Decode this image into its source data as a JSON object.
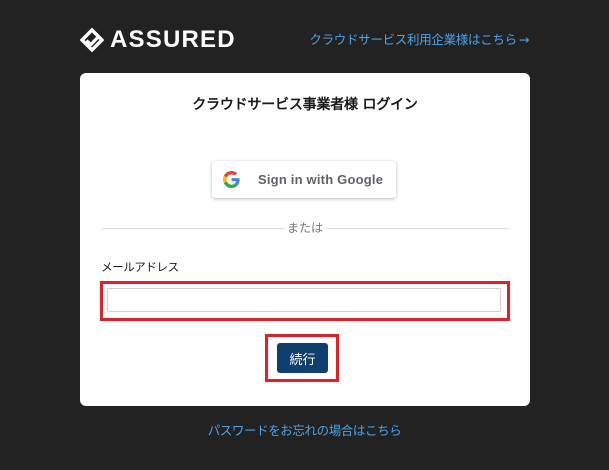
{
  "header": {
    "logo_text": "ASSURED",
    "logo_icon": "assured-check-diamond-icon",
    "enterprise_link_label": "クラウドサービス利用企業様はこちら",
    "enterprise_link_arrow": "→"
  },
  "login_card": {
    "title": "クラウドサービス事業者様 ログイン",
    "google_button_label": "Sign in with Google",
    "google_icon": "google-g-icon",
    "divider_text": "または",
    "email_label": "メールアドレス",
    "email_value": "",
    "email_placeholder": "",
    "continue_button_label": "続行"
  },
  "footer": {
    "forgot_password_label": "パスワードをお忘れの場合はこちら"
  },
  "colors": {
    "background": "#232222",
    "card": "#ffffff",
    "link": "#4aa3e8",
    "primary_button": "#0f3f6e",
    "highlight": "#e3202a"
  }
}
